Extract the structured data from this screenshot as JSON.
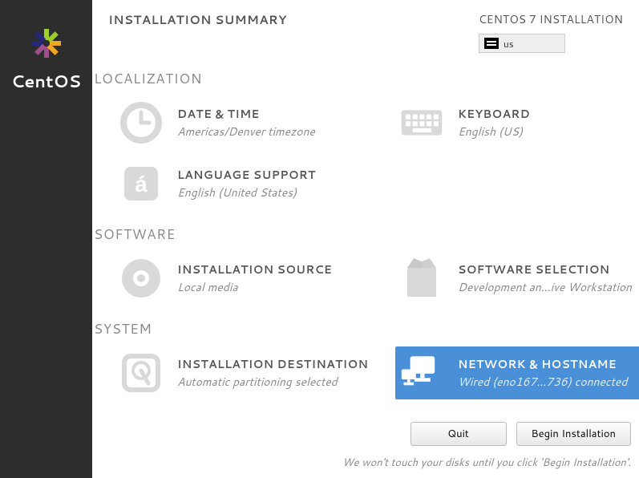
{
  "brand": "CentOS",
  "header": {
    "title": "INSTALLATION SUMMARY",
    "install_title": "CENTOS 7 INSTALLATION",
    "kb_layout": "us"
  },
  "sections": {
    "localization": {
      "title": "LOCALIZATION",
      "datetime": {
        "title": "DATE & TIME",
        "status": "Americas/Denver timezone"
      },
      "keyboard": {
        "title": "KEYBOARD",
        "status": "English (US)"
      },
      "language": {
        "title": "LANGUAGE SUPPORT",
        "status": "English (United States)"
      }
    },
    "software": {
      "title": "SOFTWARE",
      "source": {
        "title": "INSTALLATION SOURCE",
        "status": "Local media"
      },
      "selection": {
        "title": "SOFTWARE SELECTION",
        "status": "Development an…ive Workstation"
      }
    },
    "system": {
      "title": "SYSTEM",
      "destination": {
        "title": "INSTALLATION DESTINATION",
        "status": "Automatic partitioning selected"
      },
      "network": {
        "title": "NETWORK & HOSTNAME",
        "status": "Wired (eno167…736) connected"
      }
    }
  },
  "footer": {
    "quit": "Quit",
    "begin": "Begin Installation",
    "hint": "We won't touch your disks until you click 'Begin Installation'."
  }
}
